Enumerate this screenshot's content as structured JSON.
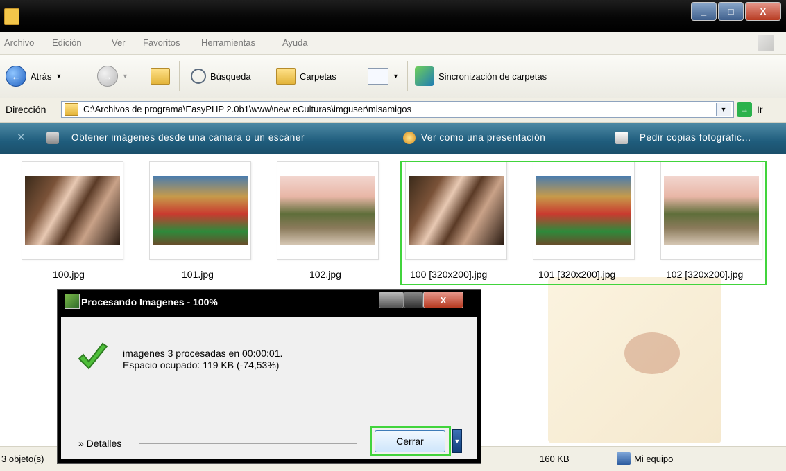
{
  "window": {
    "buttons": {
      "minimize": "_",
      "maximize": "□",
      "close": "X"
    }
  },
  "menu": [
    "Archivo",
    "Edición",
    "Ver",
    "Favoritos",
    "Herramientas",
    "Ayuda"
  ],
  "toolbar": {
    "back_label": "Atrás",
    "search_label": "Búsqueda",
    "folders_label": "Carpetas",
    "sync_label": "Sincronización de carpetas"
  },
  "address": {
    "label": "Dirección",
    "value": "C:\\Archivos de programa\\EasyPHP 2.0b1\\www\\new eCulturas\\imguser\\misamigos",
    "go_label": "Ir"
  },
  "tasks": [
    "Obtener imágenes desde una cámara o un escáner",
    "Ver como una presentación",
    "Pedir copias fotográfic..."
  ],
  "files": [
    {
      "name": "100.jpg"
    },
    {
      "name": "101.jpg"
    },
    {
      "name": "102.jpg"
    },
    {
      "name": "100 [320x200].jpg"
    },
    {
      "name": "101 [320x200].jpg"
    },
    {
      "name": "102 [320x200].jpg"
    }
  ],
  "status": {
    "objects": "3 objeto(s)",
    "size": "160 KB",
    "location": "Mi equipo"
  },
  "dialog": {
    "title": "Procesando Imagenes - 100%",
    "line1": "imagenes 3  procesadas en 00:00:01.",
    "line2": "Espacio ocupado: 119 KB (-74,53%)",
    "details_label": "» Detalles",
    "close_label": "Cerrar"
  },
  "colors": {
    "highlight": "#41d43c",
    "taskbar": "#1f5d7d"
  }
}
